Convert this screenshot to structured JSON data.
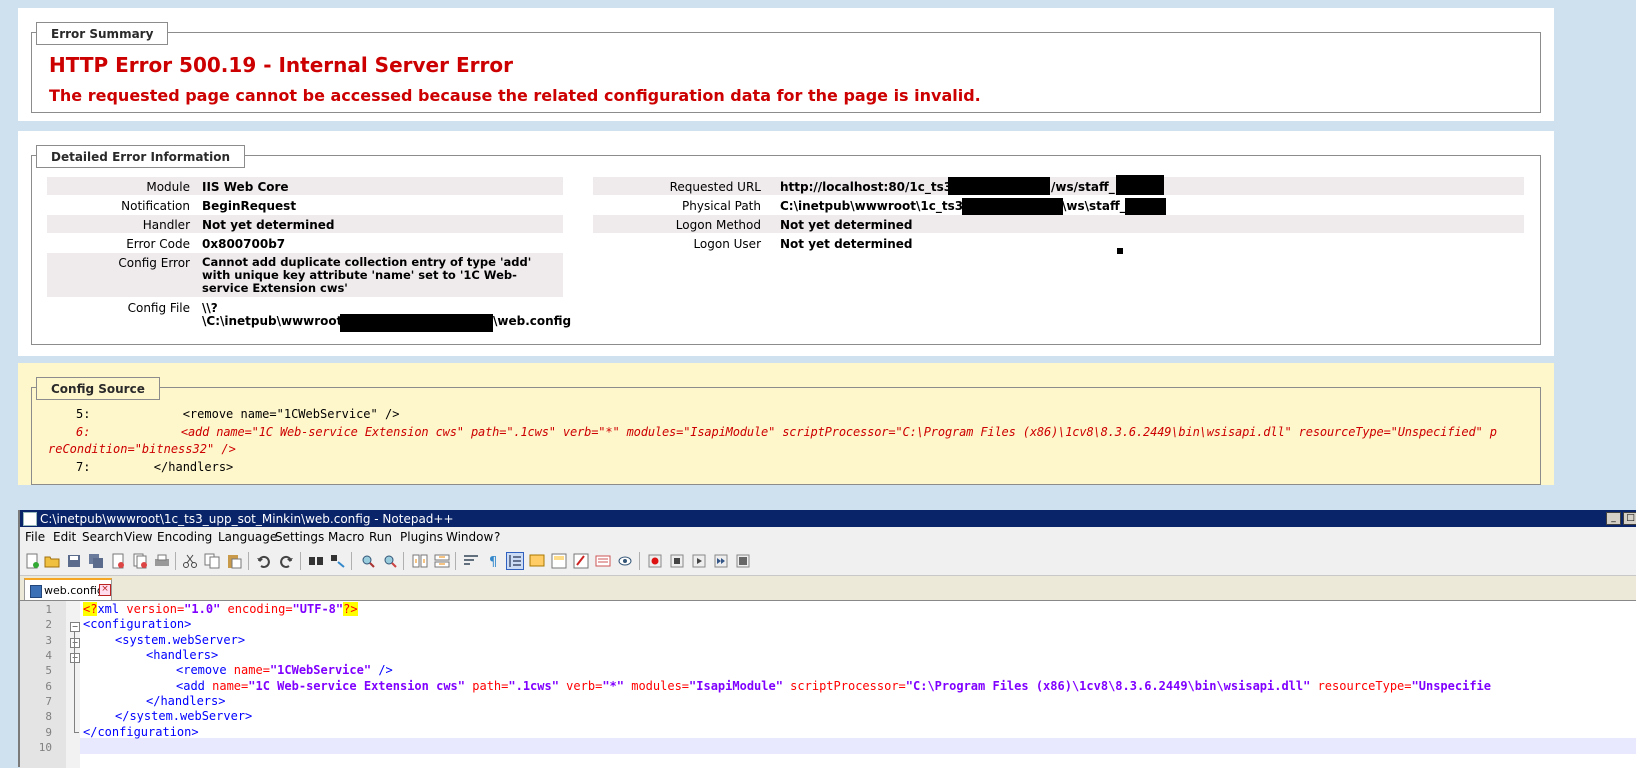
{
  "error_summary": {
    "legend": "Error Summary",
    "title": "HTTP Error 500.19 - Internal Server Error",
    "subtitle": "The requested page cannot be accessed because the related configuration data for the page is invalid."
  },
  "detailed": {
    "legend": "Detailed Error Information",
    "left": [
      {
        "label": "Module",
        "value": "IIS Web Core"
      },
      {
        "label": "Notification",
        "value": "BeginRequest"
      },
      {
        "label": "Handler",
        "value": "Not yet determined"
      },
      {
        "label": "Error Code",
        "value": "0x800700b7"
      },
      {
        "label": "Config Error",
        "value": "Cannot add duplicate collection entry of type 'add' with unique key attribute 'name' set to '1C Web-service Extension cws'"
      },
      {
        "label": "Config File",
        "value_line1": "\\\\?",
        "value_line2a": "\\C:\\inetpub\\wwwroot\\",
        "value_line2b": "\\web.config"
      }
    ],
    "right": [
      {
        "label": "Requested URL",
        "value_a": "http://localhost:80/1c_ts3_",
        "value_b": "/ws/staff_"
      },
      {
        "label": "Physical Path",
        "value_a": "C:\\inetpub\\wwwroot\\1c_ts3_",
        "value_b": "\\ws\\staff_"
      },
      {
        "label": "Logon Method",
        "value": "Not yet determined"
      },
      {
        "label": "Logon User",
        "value": "Not yet determined"
      }
    ]
  },
  "config_source": {
    "legend": "Config Source",
    "lines": [
      {
        "num": "5:",
        "text": "            <remove name=\"1CWebService\" />"
      },
      {
        "num": "6:",
        "text": "            <add name=\"1C Web-service Extension cws\" path=\".1cws\" verb=\"*\" modules=\"IsapiModule\" scriptProcessor=\"C:\\Program Files (x86)\\1cv8\\8.3.6.2449\\bin\\wsisapi.dll\" resourceType=\"Unspecified\" p"
      },
      {
        "num": "",
        "text": "reCondition=\"bitness32\" />"
      },
      {
        "num": "7:",
        "text": "        </handlers>"
      }
    ]
  },
  "notepad": {
    "title": "C:\\inetpub\\wwwroot\\1c_ts3_upp_sot_Minkin\\web.config - Notepad++",
    "menu": [
      "File",
      "Edit",
      "Search",
      "View",
      "Encoding",
      "Language",
      "Settings",
      "Macro",
      "Run",
      "Plugins",
      "Window",
      "?"
    ],
    "tab_label": "web.config",
    "line_numbers": [
      "1",
      "2",
      "3",
      "4",
      "5",
      "6",
      "7",
      "8",
      "9",
      "10"
    ],
    "toolbar_icons": [
      "new-file-icon",
      "open-file-icon",
      "save-icon",
      "save-all-icon",
      "close-icon",
      "close-all-icon",
      "print-icon",
      "cut-icon",
      "copy-icon",
      "paste-icon",
      "undo-icon",
      "redo-icon",
      "find-icon",
      "replace-icon",
      "zoom-in-icon",
      "zoom-out-icon",
      "sync-vertical-icon",
      "sync-horizontal-icon",
      "word-wrap-icon",
      "show-all-chars-icon",
      "indent-guide-icon",
      "user-language-icon",
      "doc-map-icon",
      "function-list-icon",
      "folder-workspace-icon",
      "monitoring-icon",
      "record-macro-icon",
      "stop-macro-icon",
      "play-macro-icon",
      "run-macro-multiple-icon",
      "save-macro-icon"
    ],
    "code": {
      "l1": {
        "pi_open": "<?",
        "xml": "xml",
        "v_attr": " version=",
        "v_val": "\"1.0\"",
        "e_attr": " encoding=",
        "e_val": "\"UTF-8\"",
        "pi_close": "?>"
      },
      "l2": "<configuration>",
      "l3": "<system.webServer>",
      "l4": "<handlers>",
      "l5": {
        "open": "<remove",
        "attr": " name=",
        "val": "\"1CWebService\"",
        "close": " />"
      },
      "l6": {
        "open": "<add",
        "a1": " name=",
        "v1": "\"1C Web-service Extension cws\"",
        "a2": " path=",
        "v2": "\".1cws\"",
        "a3": " verb=",
        "v3": "\"*\"",
        "a4": " modules=",
        "v4": "\"IsapiModule\"",
        "a5": " scriptProcessor=",
        "v5": "\"C:\\Program Files (x86)\\1cv8\\8.3.6.2449\\bin\\wsisapi.dll\"",
        "a6": " resourceType=",
        "v6": "\"Unspecifie"
      },
      "l7": "</handlers>",
      "l8": "</system.webServer>",
      "l9": "</configuration>"
    }
  },
  "colors": {
    "error_red": "#cc0000",
    "source_bg": "#fff7cc",
    "page_bg": "#cfe1ee",
    "npp_title_bg": "#0a246a"
  }
}
